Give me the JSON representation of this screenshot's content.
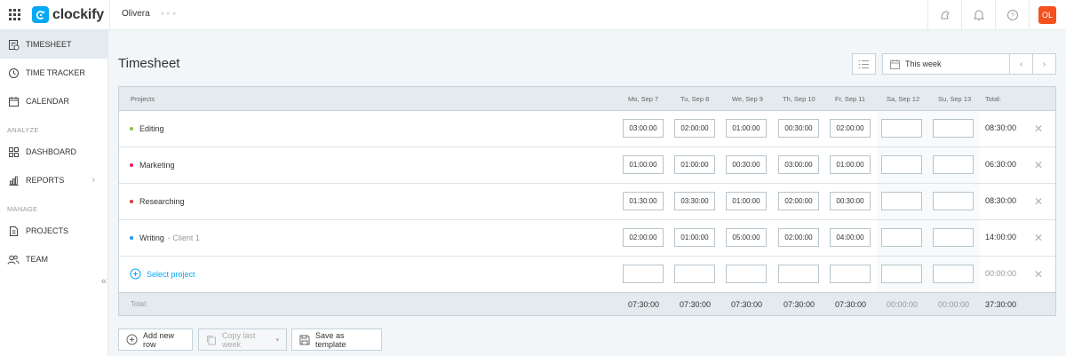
{
  "app": {
    "brand": "clockify",
    "workspace": "Olivera",
    "workspace_more": "∘∘∘",
    "avatar_initials": "OL",
    "accent": "#03a9f4",
    "avatar_color": "#f4511e"
  },
  "sidebar": {
    "items": [
      {
        "label": "TIMESHEET",
        "icon": "timesheet-icon",
        "active": true
      },
      {
        "label": "TIME TRACKER",
        "icon": "clock-icon"
      },
      {
        "label": "CALENDAR",
        "icon": "calendar-icon"
      },
      {
        "label": "DASHBOARD",
        "icon": "dashboard-icon"
      },
      {
        "label": "REPORTS",
        "icon": "reports-icon",
        "chevron": "›"
      },
      {
        "label": "PROJECTS",
        "icon": "projects-icon"
      },
      {
        "label": "TEAM",
        "icon": "team-icon"
      }
    ],
    "sections": {
      "analyze": "ANALYZE",
      "manage": "MANAGE"
    },
    "collapse": "«"
  },
  "page": {
    "title": "Timesheet",
    "week_label": "This week",
    "prev": "‹",
    "next": "›"
  },
  "table": {
    "columns": [
      "Projects",
      "Mo, Sep 7",
      "Tu, Sep 8",
      "We, Sep 9",
      "Th, Sep 10",
      "Fr, Sep 11",
      "Sa, Sep 12",
      "Su, Sep 13",
      "Total:"
    ],
    "rows": [
      {
        "project": "Editing",
        "client": "",
        "color": "#8bc34a",
        "days": [
          "03:00:00",
          "02:00:00",
          "01:00:00",
          "00:30:00",
          "02:00:00",
          "",
          ""
        ],
        "total": "08:30:00"
      },
      {
        "project": "Marketing",
        "client": "",
        "color": "#e91e63",
        "days": [
          "01:00:00",
          "01:00:00",
          "00:30:00",
          "03:00:00",
          "01:00:00",
          "",
          ""
        ],
        "total": "06:30:00"
      },
      {
        "project": "Researching",
        "client": "",
        "color": "#e53935",
        "days": [
          "01:30:00",
          "03:30:00",
          "01:00:00",
          "02:00:00",
          "00:30:00",
          "",
          ""
        ],
        "total": "08:30:00"
      },
      {
        "project": "Writing",
        "client": "- Client 1",
        "color": "#2196f3",
        "days": [
          "02:00:00",
          "01:00:00",
          "05:00:00",
          "02:00:00",
          "04:00:00",
          "",
          ""
        ],
        "total": "14:00:00"
      }
    ],
    "new_row": {
      "label": "Select project",
      "total": "00:00:00"
    },
    "footer": {
      "label": "Total:",
      "days": [
        "07:30:00",
        "07:30:00",
        "07:30:00",
        "07:30:00",
        "07:30:00",
        "00:00:00",
        "00:00:00"
      ],
      "total": "37:30:00"
    },
    "delete_glyph": "✕"
  },
  "actions": {
    "add_row": "Add new row",
    "copy_last_week": "Copy last week",
    "copy_caret": "▾",
    "save_template": "Save as template"
  }
}
